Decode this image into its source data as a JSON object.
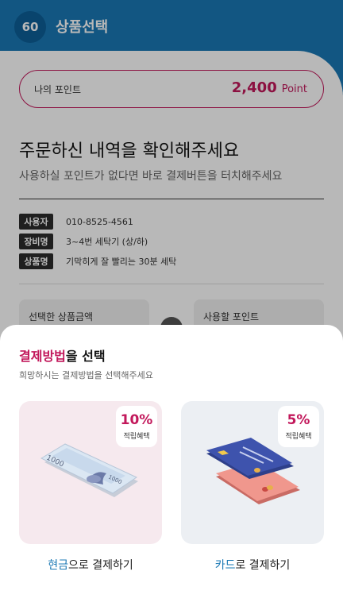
{
  "header": {
    "timer": "60",
    "title": "상품선택"
  },
  "points": {
    "label": "나의 포인트",
    "value": "2,400",
    "unit": "Point"
  },
  "confirm": {
    "heading": "주문하신 내역을 확인해주세요",
    "subheading": "사용하실 포인트가 없다면 바로 결제버튼을 터치해주세요"
  },
  "order_info": [
    {
      "tag": "사용자",
      "value": "010-8525-4561"
    },
    {
      "tag": "장비명",
      "value": "3~4번 세탁기 (상/하)"
    },
    {
      "tag": "상품명",
      "value": "기막히게 잘 빨리는 30분 세탁"
    }
  ],
  "summary": {
    "product_amount_label": "선택한 상품금액",
    "use_points_label": "사용할 포인트"
  },
  "payment_sheet": {
    "title_accent": "결제방법",
    "title_rest": "을 선택",
    "subtitle": "희망하시는 결제방법을 선택해주세요",
    "options": [
      {
        "benefit_pct": "10%",
        "benefit_label": "적립혜택",
        "label_highlight": "현금",
        "label_rest": "으로 결제하기",
        "banknote_text": "1000"
      },
      {
        "benefit_pct": "5%",
        "benefit_label": "적립혜택",
        "label_highlight": "카드",
        "label_rest": "로 결제하기"
      }
    ]
  },
  "colors": {
    "primary_blue": "#1a78b4",
    "accent_pink": "#c2185b"
  }
}
